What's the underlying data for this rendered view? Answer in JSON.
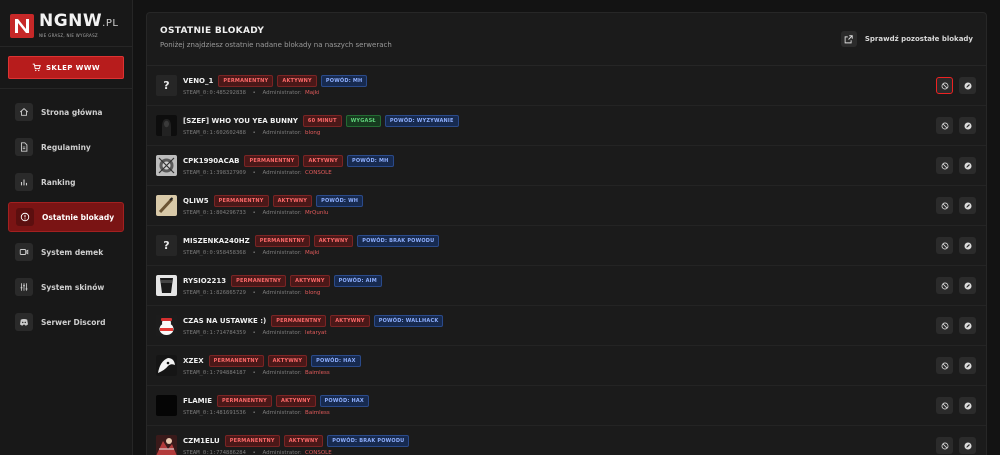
{
  "brand": {
    "name": "NGNW",
    "tld": ".PL",
    "tagline": "NIE GRASZ, NIE WYGRASZ"
  },
  "sidebar": {
    "shop_label": "SKLEP WWW",
    "items": [
      {
        "label": "Strona główna",
        "icon": "home-icon",
        "active": false
      },
      {
        "label": "Regulaminy",
        "icon": "document-icon",
        "active": false
      },
      {
        "label": "Ranking",
        "icon": "bar-chart-icon",
        "active": false
      },
      {
        "label": "Ostatnie blokady",
        "icon": "alert-circle-icon",
        "active": true
      },
      {
        "label": "System demek",
        "icon": "video-icon",
        "active": false
      },
      {
        "label": "System skinów",
        "icon": "sliders-icon",
        "active": false
      },
      {
        "label": "Serwer Discord",
        "icon": "discord-icon",
        "active": false
      }
    ]
  },
  "panel": {
    "title": "OSTATNIE BLOKADY",
    "subtitle": "Poniżej znajdziesz ostatnie nadane blokady na naszych serwerach",
    "check_label": "Sprawdź pozostałe blokady"
  },
  "admin_label": "Administrator:",
  "bans": [
    {
      "nick": "VENO_1",
      "avatar": "?",
      "badges": [
        [
          "PERMANENTNY",
          "perm"
        ],
        [
          "AKTYWNY",
          "red"
        ],
        [
          "POWÓD: MH",
          "blue"
        ]
      ],
      "steam": "STEAM_0:0:485292838",
      "admin": "Majki"
    },
    {
      "nick": "[SZEF] WHO YOU YEA BUNNY",
      "avatar": "",
      "badges": [
        [
          "60 MINUT",
          "red"
        ],
        [
          "WYGASŁ",
          "green"
        ],
        [
          "POWÓD: WYZYWANIE",
          "blue"
        ]
      ],
      "steam": "STEAM_0:1:602602488",
      "admin": "blong"
    },
    {
      "nick": "CPK1990ACAB",
      "avatar": "",
      "badges": [
        [
          "PERMANENTNY",
          "perm"
        ],
        [
          "AKTYWNY",
          "red"
        ],
        [
          "POWÓD: MH",
          "blue"
        ]
      ],
      "steam": "STEAM_0:1:398327909",
      "admin": "CONSOLE"
    },
    {
      "nick": "QLIW5",
      "avatar": "",
      "badges": [
        [
          "PERMANENTNY",
          "perm"
        ],
        [
          "AKTYWNY",
          "red"
        ],
        [
          "POWÓD: WH",
          "blue"
        ]
      ],
      "steam": "STEAM_0:1:804296733",
      "admin": "MrQunlu"
    },
    {
      "nick": "MISZENKA240HZ",
      "avatar": "?",
      "badges": [
        [
          "PERMANENTNY",
          "perm"
        ],
        [
          "AKTYWNY",
          "red"
        ],
        [
          "POWÓD: BRAK POWODU",
          "blue"
        ]
      ],
      "steam": "STEAM_0:0:958458368",
      "admin": "Majki"
    },
    {
      "nick": "RYSIO2213",
      "avatar": "",
      "badges": [
        [
          "PERMANENTNY",
          "perm"
        ],
        [
          "AKTYWNY",
          "red"
        ],
        [
          "POWÓD: AIM",
          "blue"
        ]
      ],
      "steam": "STEAM_0:1:826865729",
      "admin": "blong"
    },
    {
      "nick": "CZAS NA USTAWKE :)",
      "avatar": "",
      "badges": [
        [
          "PERMANENTNY",
          "perm"
        ],
        [
          "AKTYWNY",
          "red"
        ],
        [
          "POWÓD: WALLHACK",
          "blue"
        ]
      ],
      "steam": "STEAM_0:1:714784359",
      "admin": "letaryat"
    },
    {
      "nick": "XZEX",
      "avatar": "",
      "badges": [
        [
          "PERMANENTNY",
          "perm"
        ],
        [
          "AKTYWNY",
          "red"
        ],
        [
          "POWÓD: HAX",
          "blue"
        ]
      ],
      "steam": "STEAM_0:1:794884187",
      "admin": "Baimless"
    },
    {
      "nick": "FLAMIE",
      "avatar": "",
      "badges": [
        [
          "PERMANENTNY",
          "perm"
        ],
        [
          "AKTYWNY",
          "red"
        ],
        [
          "POWÓD: HAX",
          "blue"
        ]
      ],
      "steam": "STEAM_0:1:481691536",
      "admin": "Baimless"
    },
    {
      "nick": "CZM1ELU",
      "avatar": "",
      "badges": [
        [
          "PERMANENTNY",
          "perm"
        ],
        [
          "AKTYWNY",
          "red"
        ],
        [
          "POWÓD: BRAK POWODU",
          "blue"
        ]
      ],
      "steam": "STEAM_0:1:774886284",
      "admin": "CONSOLE"
    }
  ],
  "colors": {
    "accent": "#b71c1c",
    "active_bg": "#7a1414",
    "admin": "#e35b5b"
  }
}
